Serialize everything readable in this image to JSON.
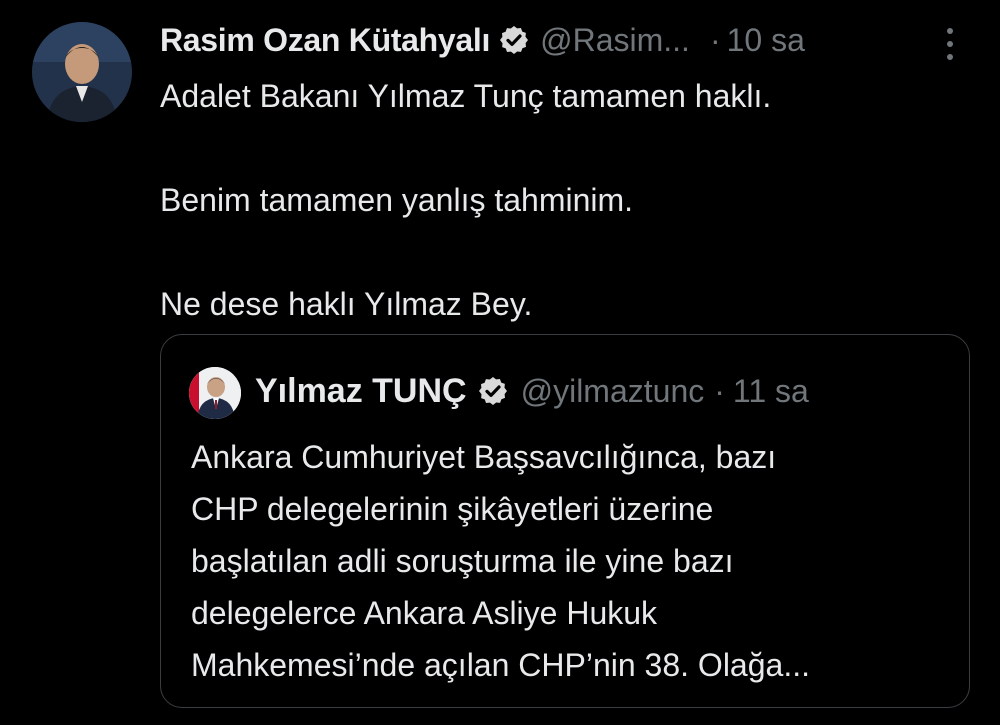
{
  "tweet": {
    "author_name": "Rasim Ozan Kütahyalı",
    "author_handle": "@Rasim...",
    "separator": "·",
    "time": "10 sa",
    "body_lines": [
      "Adalet Bakanı Yılmaz Tunç tamamen haklı.",
      "Benim tamamen yanlış tahminim.",
      "Ne dese haklı Yılmaz Bey."
    ],
    "icons": {
      "verified": "verified-badge-icon",
      "more": "more-options-icon"
    }
  },
  "quoted_tweet": {
    "author_name": "Yılmaz TUNÇ",
    "author_handle": "@yilmaztunc",
    "separator": "·",
    "time": "11 sa",
    "body_lines": [
      "Ankara Cumhuriyet Başsavcılığınca, bazı",
      "CHP delegelerinin şikâyetleri üzerine",
      "başlatılan adli soruşturma ile yine bazı",
      "delegelerce Ankara Asliye Hukuk",
      "Mahkemesi’nde açılan CHP’nin 38. Olağa..."
    ]
  },
  "colors": {
    "background": "#000000",
    "text": "#e7e9ea",
    "secondary": "#71767b",
    "border": "#3a3d41",
    "verified": "#d9d9d9"
  }
}
